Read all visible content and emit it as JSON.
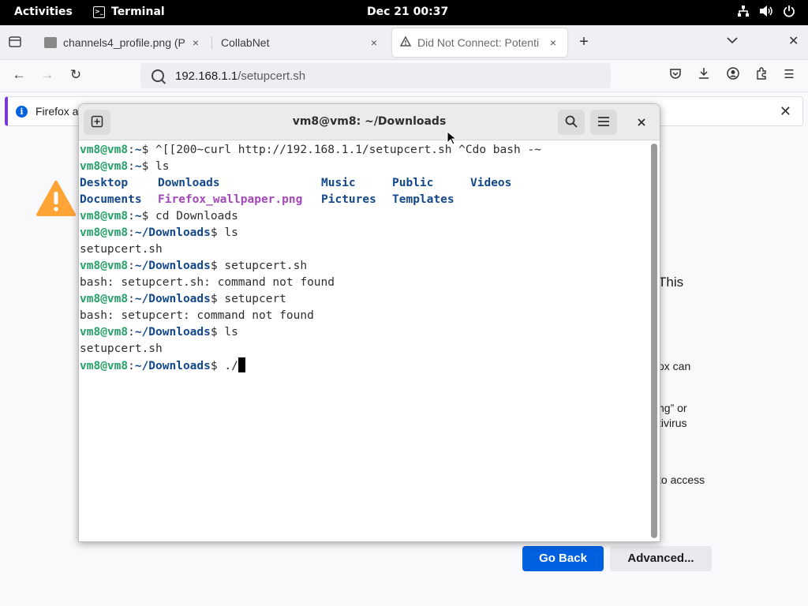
{
  "topbar": {
    "activities": "Activities",
    "app": "Terminal",
    "clock": "Dec 21  00:37",
    "tray_icons": [
      "network-icon",
      "volume-icon",
      "power-icon"
    ]
  },
  "tabs": [
    {
      "title": "channels4_profile.png (P",
      "close": "×"
    },
    {
      "title": "CollabNet",
      "close": "×"
    },
    {
      "title": "Did Not Connect: Potenti",
      "close": "×"
    }
  ],
  "nav": {
    "url_host": "192.168.1.1",
    "url_path": "/setupcert.sh"
  },
  "notification": {
    "text": "Firefox a"
  },
  "errorpage": {
    "fragments": [
      "This",
      "ox can",
      "ng” or",
      "tivirus",
      "to access"
    ],
    "go_back": "Go Back",
    "advanced": "Advanced..."
  },
  "terminal": {
    "title": "vm8@vm8: ~/Downloads",
    "user": "vm8@vm8",
    "lines": [
      {
        "path": "~",
        "cmd": " ^[[200~curl http://192.168.1.1/setupcert.sh ^Cdo bash -~"
      },
      {
        "path": "~",
        "cmd": " ls"
      },
      {
        "path": "~",
        "cmd": " cd Downloads"
      },
      {
        "path": "~/Downloads",
        "cmd": " ls"
      },
      {
        "output": "setupcert.sh"
      },
      {
        "path": "~/Downloads",
        "cmd": " setupcert.sh"
      },
      {
        "output": "bash: setupcert.sh: command not found"
      },
      {
        "path": "~/Downloads",
        "cmd": " setupcert"
      },
      {
        "output": "bash: setupcert: command not found"
      },
      {
        "path": "~/Downloads",
        "cmd": " ls"
      },
      {
        "output": "setupcert.sh"
      },
      {
        "path": "~/Downloads",
        "cmd": " ./"
      }
    ],
    "ls_home": [
      [
        "Desktop",
        "Downloads",
        "Music",
        "Public",
        "Videos"
      ],
      [
        "Documents",
        "Firefox_wallpaper.png",
        "Pictures",
        "Templates",
        ""
      ]
    ]
  }
}
